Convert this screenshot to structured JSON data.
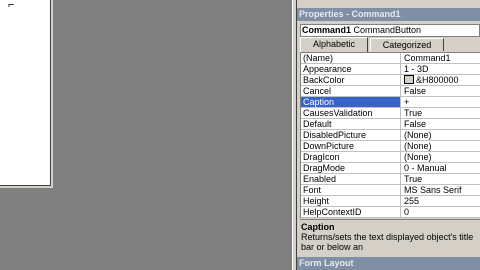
{
  "form": {
    "grip_symbol": "⌐"
  },
  "properties_window": {
    "title": "Properties - Command1",
    "object_name": "Command1",
    "object_type": "CommandButton",
    "tabs": [
      {
        "label": "Alphabetic",
        "active": true
      },
      {
        "label": "Categorized",
        "active": false
      }
    ],
    "rows": [
      {
        "name": "(Name)",
        "value": "Command1"
      },
      {
        "name": "Appearance",
        "value": "1 - 3D"
      },
      {
        "name": "BackColor",
        "value": "&H800000",
        "swatch": true
      },
      {
        "name": "Cancel",
        "value": "False"
      },
      {
        "name": "Caption",
        "value": "+",
        "selected": true
      },
      {
        "name": "CausesValidation",
        "value": "True"
      },
      {
        "name": "Default",
        "value": "False"
      },
      {
        "name": "DisabledPicture",
        "value": "(None)"
      },
      {
        "name": "DownPicture",
        "value": "(None)"
      },
      {
        "name": "DragIcon",
        "value": "(None)"
      },
      {
        "name": "DragMode",
        "value": "0 - Manual"
      },
      {
        "name": "Enabled",
        "value": "True"
      },
      {
        "name": "Font",
        "value": "MS Sans Serif"
      },
      {
        "name": "Height",
        "value": "255"
      },
      {
        "name": "HelpContextID",
        "value": "0"
      }
    ],
    "description": {
      "title": "Caption",
      "text": "Returns/sets the text displayed object's title bar or below an"
    }
  },
  "form_layout": {
    "title": "Form Layout"
  },
  "colors": {
    "titlebar": "#7f8fa6",
    "selection": "#3a63c8",
    "panel": "#d4d0c8",
    "workspace": "#808080"
  }
}
